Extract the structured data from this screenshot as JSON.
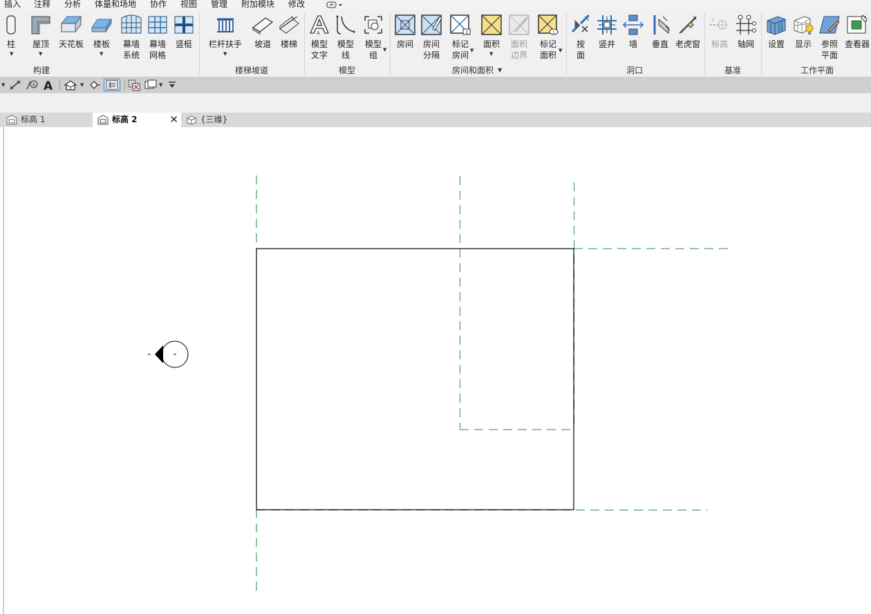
{
  "menu": {
    "tabs": [
      "插入",
      "注释",
      "分析",
      "体量和场地",
      "协作",
      "视图",
      "管理",
      "附加模块",
      "修改"
    ]
  },
  "ribbon": {
    "panels": {
      "build": {
        "label": "构建",
        "buttons": {
          "column": "柱",
          "roof": "屋顶",
          "ceiling": "天花板",
          "floor": "楼板",
          "curtain_system": "幕墙\n系统",
          "curtain_grid": "幕墙\n网格",
          "mullion": "竖梃"
        }
      },
      "circulation": {
        "label": "楼梯坡道",
        "buttons": {
          "railing": "栏杆扶手",
          "ramp": "坡道",
          "stair": "楼梯"
        }
      },
      "model": {
        "label": "模型",
        "buttons": {
          "model_text": "模型\n文字",
          "model_line": "模型\n线",
          "model_group": "模型\n组"
        }
      },
      "room_area": {
        "label": "房间和面积",
        "buttons": {
          "room": "房间",
          "room_separator": "房间\n分隔",
          "tag_room": "标记\n房间",
          "area": "面积",
          "area_boundary": "面积\n边界",
          "tag_area": "标记\n面积"
        }
      },
      "opening": {
        "label": "洞口",
        "buttons": {
          "by_face": "按\n面",
          "shaft": "竖井",
          "wall": "墙",
          "vertical": "垂直",
          "dormer": "老虎窗"
        }
      },
      "datum": {
        "label": "基准",
        "buttons": {
          "level": "标高",
          "grid": "轴网"
        }
      },
      "work_plane": {
        "label": "工作平面",
        "buttons": {
          "set": "设置",
          "show": "显示",
          "ref_plane": "参照\n平面",
          "viewer": "查看器"
        }
      }
    }
  },
  "view_tabs": [
    {
      "label": "标高 1",
      "active": false
    },
    {
      "label": "标高 2",
      "active": true
    },
    {
      "label": "{三维}",
      "active": false
    }
  ],
  "colors": {
    "grid_line": "#2e8b3a",
    "wall_line": "#000000",
    "ribbon_bg": "#f0f0f0",
    "options_bg": "#cfcfcf",
    "viewtab_bg": "#d9d9d9",
    "selected_outline": "#3f78c2"
  },
  "icons": {
    "options_bar": [
      "dimension-icon",
      "spot-elevation-icon",
      "text-icon",
      "home-view-icon",
      "pin-icon",
      "properties-icon",
      "hide-element-icon",
      "switch-windows-icon",
      "customize-icon"
    ],
    "view_tabs": [
      "floor-plan-icon",
      "floor-plan-icon",
      "3d-view-icon"
    ]
  }
}
